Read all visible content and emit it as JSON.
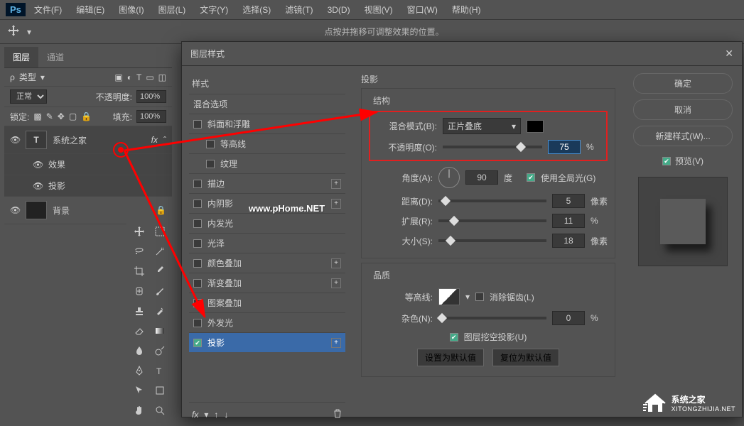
{
  "menu": {
    "items": [
      "文件(F)",
      "编辑(E)",
      "图像(I)",
      "图层(L)",
      "文字(Y)",
      "选择(S)",
      "滤镜(T)",
      "3D(D)",
      "视图(V)",
      "窗口(W)",
      "帮助(H)"
    ]
  },
  "toolbar": {
    "hint": "点按并拖移可调整效果的位置。"
  },
  "layers_panel": {
    "tabs": [
      "图层",
      "通道"
    ],
    "type_label": "类型",
    "blend_mode": "正常",
    "opacity_label": "不透明度:",
    "opacity_value": "100%",
    "lock_label": "锁定:",
    "fill_label": "填充:",
    "fill_value": "100%",
    "layer1": {
      "name": "系统之家",
      "thumb": "T",
      "fx": "fx"
    },
    "layer1_fx": {
      "label": "效果",
      "sub": "投影"
    },
    "layer2": {
      "name": "背景"
    }
  },
  "dialog": {
    "title": "图层样式",
    "styles": {
      "header": "样式",
      "blending": "混合选项",
      "items": [
        {
          "label": "斜面和浮雕",
          "checked": false,
          "indent": 0
        },
        {
          "label": "等高线",
          "checked": false,
          "indent": 1
        },
        {
          "label": "纹理",
          "checked": false,
          "indent": 1
        },
        {
          "label": "描边",
          "checked": false,
          "indent": 0,
          "plus": true
        },
        {
          "label": "内阴影",
          "checked": false,
          "indent": 0,
          "plus": true
        },
        {
          "label": "内发光",
          "checked": false,
          "indent": 0
        },
        {
          "label": "光泽",
          "checked": false,
          "indent": 0
        },
        {
          "label": "颜色叠加",
          "checked": false,
          "indent": 0,
          "plus": true
        },
        {
          "label": "渐变叠加",
          "checked": false,
          "indent": 0,
          "plus": true
        },
        {
          "label": "图案叠加",
          "checked": false,
          "indent": 0
        },
        {
          "label": "外发光",
          "checked": false,
          "indent": 0
        },
        {
          "label": "投影",
          "checked": true,
          "indent": 0,
          "plus": true,
          "selected": true
        }
      ]
    },
    "settings": {
      "panel_title": "投影",
      "structure": "结构",
      "blend_mode_label": "混合模式(B):",
      "blend_mode_value": "正片叠底",
      "opacity_label": "不透明度(O):",
      "opacity_value": "75",
      "percent": "%",
      "angle_label": "角度(A):",
      "angle_value": "90",
      "degree": "度",
      "global_light": "使用全局光(G)",
      "distance_label": "距离(D):",
      "distance_value": "5",
      "px": "像素",
      "spread_label": "扩展(R):",
      "spread_value": "11",
      "size_label": "大小(S):",
      "size_value": "18",
      "quality": "品质",
      "contour_label": "等高线:",
      "antialias": "消除锯齿(L)",
      "noise_label": "杂色(N):",
      "noise_value": "0",
      "knockout": "图层挖空投影(U)",
      "make_default": "设置为默认值",
      "reset_default": "复位为默认值"
    },
    "buttons": {
      "ok": "确定",
      "cancel": "取消",
      "new_style": "新建样式(W)...",
      "preview": "预览(V)"
    }
  },
  "watermarks": {
    "phome": "www.pHome.NET",
    "sz_name": "系统之家",
    "sz_url": "XITONGZHIJIA.NET"
  },
  "symbols": {
    "close": "✕",
    "dropdown": "▾",
    "check": "✔",
    "lock": "🔒",
    "plus": "+",
    "fx": "fx"
  }
}
